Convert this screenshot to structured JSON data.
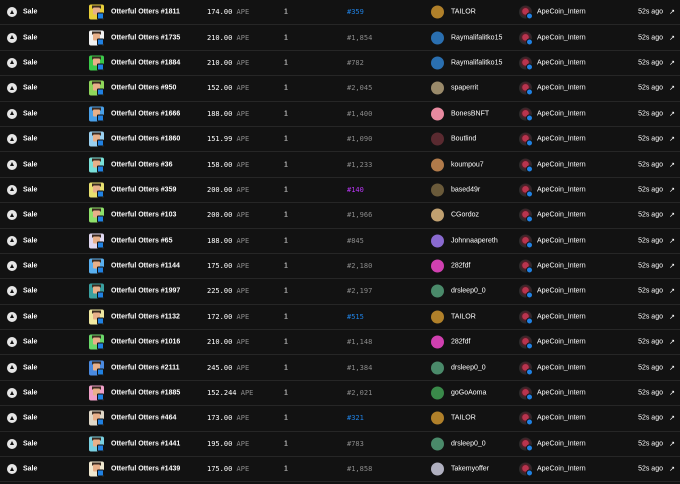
{
  "colors": {
    "background": "#121212",
    "row_border": "#262626",
    "rare_blue": "#2081e2",
    "rare_purple": "#b936f5",
    "muted": "#8a8a8a"
  },
  "external_link_icon": "arrow-up-right-icon",
  "rows": [
    {
      "type": "Sale",
      "item": "Otterful Otters #1811",
      "price": "174.00",
      "currency": "APE",
      "qty": "1",
      "rarity": "#359",
      "rarity_class": "blue",
      "from": "TAILOR",
      "to": "ApeCoin_Intern",
      "time": "52s ago",
      "thumb_bg": "#e8cf3a",
      "from_avatar_bg": "#b0802a"
    },
    {
      "type": "Sale",
      "item": "Otterful Otters #1735",
      "price": "210.00",
      "currency": "APE",
      "qty": "1",
      "rarity": "#1,854",
      "rarity_class": "",
      "from": "Raymalifalitko15",
      "to": "ApeCoin_Intern",
      "time": "52s ago",
      "thumb_bg": "#f2f2f2",
      "from_avatar_bg": "#2a6fb0"
    },
    {
      "type": "Sale",
      "item": "Otterful Otters #1884",
      "price": "210.00",
      "currency": "APE",
      "qty": "1",
      "rarity": "#782",
      "rarity_class": "",
      "from": "Raymalifalitko15",
      "to": "ApeCoin_Intern",
      "time": "52s ago",
      "thumb_bg": "#3cc94a",
      "from_avatar_bg": "#2a6fb0"
    },
    {
      "type": "Sale",
      "item": "Otterful Otters #950",
      "price": "152.00",
      "currency": "APE",
      "qty": "1",
      "rarity": "#2,045",
      "rarity_class": "",
      "from": "spaperrit",
      "to": "ApeCoin_Intern",
      "time": "52s ago",
      "thumb_bg": "#8fd65a",
      "from_avatar_bg": "#9a8a6a"
    },
    {
      "type": "Sale",
      "item": "Otterful Otters #1666",
      "price": "188.00",
      "currency": "APE",
      "qty": "1",
      "rarity": "#1,400",
      "rarity_class": "",
      "from": "BonesBNFT",
      "to": "ApeCoin_Intern",
      "time": "52s ago",
      "thumb_bg": "#4aa0e8",
      "from_avatar_bg": "#e88aa0"
    },
    {
      "type": "Sale",
      "item": "Otterful Otters #1860",
      "price": "151.99",
      "currency": "APE",
      "qty": "1",
      "rarity": "#1,090",
      "rarity_class": "",
      "from": "Boutlind",
      "to": "ApeCoin_Intern",
      "time": "52s ago",
      "thumb_bg": "#9ad0f0",
      "from_avatar_bg": "#5a2a30"
    },
    {
      "type": "Sale",
      "item": "Otterful Otters #36",
      "price": "158.00",
      "currency": "APE",
      "qty": "1",
      "rarity": "#1,233",
      "rarity_class": "",
      "from": "koumpou7",
      "to": "ApeCoin_Intern",
      "time": "52s ago",
      "thumb_bg": "#7ae0d8",
      "from_avatar_bg": "#b07a4a"
    },
    {
      "type": "Sale",
      "item": "Otterful Otters #359",
      "price": "200.00",
      "currency": "APE",
      "qty": "1",
      "rarity": "#140",
      "rarity_class": "purple",
      "from": "based49r",
      "to": "ApeCoin_Intern",
      "time": "52s ago",
      "thumb_bg": "#e8e070",
      "from_avatar_bg": "#6a5a3a"
    },
    {
      "type": "Sale",
      "item": "Otterful Otters #103",
      "price": "200.00",
      "currency": "APE",
      "qty": "1",
      "rarity": "#1,966",
      "rarity_class": "",
      "from": "CGordoz",
      "to": "ApeCoin_Intern",
      "time": "52s ago",
      "thumb_bg": "#8fe06a",
      "from_avatar_bg": "#c0a070"
    },
    {
      "type": "Sale",
      "item": "Otterful Otters #65",
      "price": "188.00",
      "currency": "APE",
      "qty": "1",
      "rarity": "#845",
      "rarity_class": "",
      "from": "Johnnaapereth",
      "to": "ApeCoin_Intern",
      "time": "52s ago",
      "thumb_bg": "#e0d8f0",
      "from_avatar_bg": "#8a6ad0"
    },
    {
      "type": "Sale",
      "item": "Otterful Otters #1144",
      "price": "175.00",
      "currency": "APE",
      "qty": "1",
      "rarity": "#2,180",
      "rarity_class": "",
      "from": "282fdf",
      "to": "ApeCoin_Intern",
      "time": "52s ago",
      "thumb_bg": "#5ab0f0",
      "from_avatar_bg": "#d040b0"
    },
    {
      "type": "Sale",
      "item": "Otterful Otters #1997",
      "price": "225.00",
      "currency": "APE",
      "qty": "1",
      "rarity": "#2,197",
      "rarity_class": "",
      "from": "drsleep0_0",
      "to": "ApeCoin_Intern",
      "time": "52s ago",
      "thumb_bg": "#3aa0a0",
      "from_avatar_bg": "#4a8a6a"
    },
    {
      "type": "Sale",
      "item": "Otterful Otters #1132",
      "price": "172.00",
      "currency": "APE",
      "qty": "1",
      "rarity": "#515",
      "rarity_class": "blue",
      "from": "TAILOR",
      "to": "ApeCoin_Intern",
      "time": "52s ago",
      "thumb_bg": "#f0e8a0",
      "from_avatar_bg": "#b0802a"
    },
    {
      "type": "Sale",
      "item": "Otterful Otters #1016",
      "price": "210.00",
      "currency": "APE",
      "qty": "1",
      "rarity": "#1,148",
      "rarity_class": "",
      "from": "282fdf",
      "to": "ApeCoin_Intern",
      "time": "52s ago",
      "thumb_bg": "#6ad86a",
      "from_avatar_bg": "#d040b0"
    },
    {
      "type": "Sale",
      "item": "Otterful Otters #2111",
      "price": "245.00",
      "currency": "APE",
      "qty": "1",
      "rarity": "#1,384",
      "rarity_class": "",
      "from": "drsleep0_0",
      "to": "ApeCoin_Intern",
      "time": "52s ago",
      "thumb_bg": "#4a8ae0",
      "from_avatar_bg": "#4a8a6a"
    },
    {
      "type": "Sale",
      "item": "Otterful Otters #1885",
      "price": "152.244",
      "currency": "APE",
      "qty": "1",
      "rarity": "#2,021",
      "rarity_class": "",
      "from": "goGoAoma",
      "to": "ApeCoin_Intern",
      "time": "52s ago",
      "thumb_bg": "#f0a0c8",
      "from_avatar_bg": "#3a8a4a"
    },
    {
      "type": "Sale",
      "item": "Otterful Otters #464",
      "price": "173.00",
      "currency": "APE",
      "qty": "1",
      "rarity": "#321",
      "rarity_class": "blue",
      "from": "TAILOR",
      "to": "ApeCoin_Intern",
      "time": "52s ago",
      "thumb_bg": "#e0d8c8",
      "from_avatar_bg": "#b0802a"
    },
    {
      "type": "Sale",
      "item": "Otterful Otters #1441",
      "price": "195.00",
      "currency": "APE",
      "qty": "1",
      "rarity": "#783",
      "rarity_class": "",
      "from": "drsleep0_0",
      "to": "ApeCoin_Intern",
      "time": "52s ago",
      "thumb_bg": "#7ad0e0",
      "from_avatar_bg": "#4a8a6a"
    },
    {
      "type": "Sale",
      "item": "Otterful Otters #1439",
      "price": "175.00",
      "currency": "APE",
      "qty": "1",
      "rarity": "#1,858",
      "rarity_class": "",
      "from": "Takemyoffer",
      "to": "ApeCoin_Intern",
      "time": "52s ago",
      "thumb_bg": "#f0e8d0",
      "from_avatar_bg": "#b0b0c0"
    }
  ]
}
